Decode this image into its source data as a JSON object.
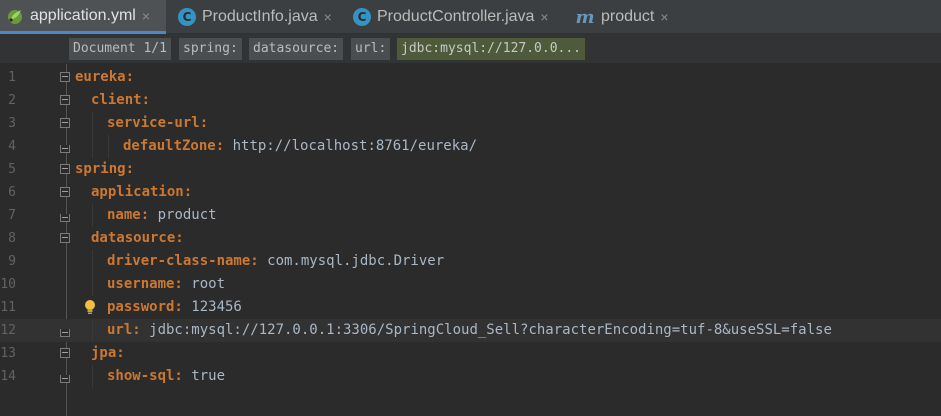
{
  "tabs": [
    {
      "label": "application.yml",
      "icon": "spring-leaf-icon",
      "active": true
    },
    {
      "label": "ProductInfo.java",
      "icon": "class-icon",
      "active": false
    },
    {
      "label": "ProductController.java",
      "icon": "class-icon",
      "active": false
    },
    {
      "label": "product",
      "icon": "maven-icon",
      "active": false
    }
  ],
  "close_glyph": "×",
  "class_glyph": "C",
  "maven_glyph": "m",
  "breadcrumb": [
    "Document 1/1",
    "spring:",
    "datasource:",
    "url:",
    "jdbc:mysql://127.0.0..."
  ],
  "lines": [
    {
      "num": "1",
      "key": "eureka:",
      "value": ""
    },
    {
      "num": "2",
      "key": "client:",
      "value": ""
    },
    {
      "num": "3",
      "key": "service-url:",
      "value": ""
    },
    {
      "num": "4",
      "key": "defaultZone:",
      "value": " http://localhost:8761/eureka/"
    },
    {
      "num": "5",
      "key": "spring:",
      "value": ""
    },
    {
      "num": "6",
      "key": "application:",
      "value": ""
    },
    {
      "num": "7",
      "key": "name:",
      "value": " product"
    },
    {
      "num": "8",
      "key": "datasource:",
      "value": ""
    },
    {
      "num": "9",
      "key": "driver-class-name:",
      "value": " com.mysql.jdbc.Driver"
    },
    {
      "num": "10",
      "key": "username:",
      "value": " root"
    },
    {
      "num": "11",
      "key": "password:",
      "value": " 123456"
    },
    {
      "num": "12",
      "key": "url:",
      "value": " jdbc:mysql://127.0.0.1:3306/SpringCloud_Sell?characterEncoding=tuf-8&useSSL=false"
    },
    {
      "num": "13",
      "key": "jpa:",
      "value": ""
    },
    {
      "num": "14",
      "key": "show-sql:",
      "value": " true"
    }
  ],
  "colors": {
    "key": "#cc7832",
    "value": "#a9b7c6",
    "accent": "#4a88c7"
  }
}
